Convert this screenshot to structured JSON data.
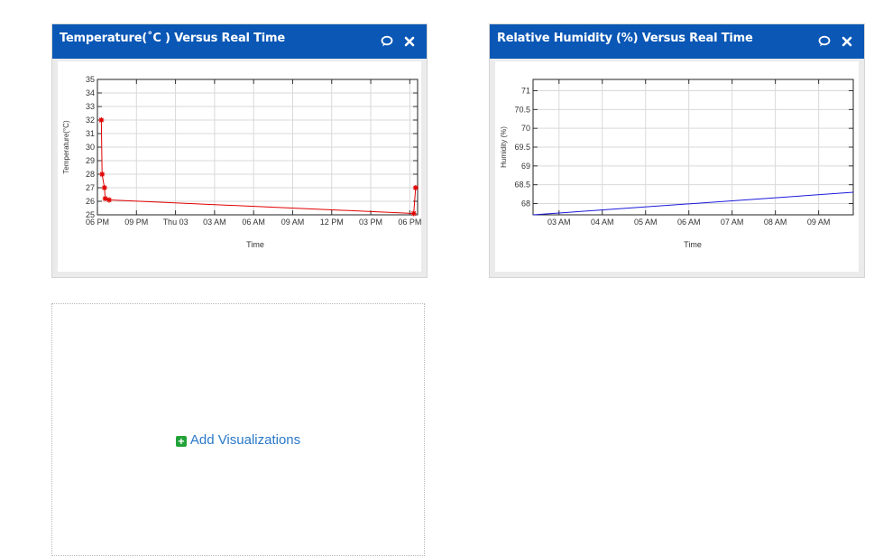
{
  "widgets": [
    {
      "title": "Temperature(˚C ) Versus Real Time",
      "comment_icon": "comment-icon",
      "close_icon": "close-icon"
    },
    {
      "title": "Relative Humidity (%) Versus Real Time",
      "comment_icon": "comment-icon",
      "close_icon": "close-icon"
    }
  ],
  "add": {
    "label": "Add Visualizations",
    "icon": "plus-square-icon",
    "color": "#22a33a"
  },
  "colors": {
    "header": "#0a57b5",
    "link": "#2a78c8"
  },
  "chart_data": [
    {
      "type": "line",
      "title": "",
      "xlabel": "Time",
      "ylabel": "Temperature(°C)",
      "ylim": [
        25,
        35
      ],
      "yticks": [
        "25",
        "26",
        "27",
        "28",
        "29",
        "30",
        "31",
        "32",
        "33",
        "34",
        "35"
      ],
      "xticks": [
        "06 PM",
        "09 PM",
        "Thu 03",
        "03 AM",
        "06 AM",
        "09 AM",
        "12 PM",
        "03 PM",
        "06 PM"
      ],
      "grid": true,
      "series": [
        {
          "color": "#e00000",
          "marker": "star",
          "points": [
            {
              "x": 0.1,
              "y": 32.0
            },
            {
              "x": 0.12,
              "y": 28.0
            },
            {
              "x": 0.18,
              "y": 27.0
            },
            {
              "x": 0.2,
              "y": 26.2
            },
            {
              "x": 0.3,
              "y": 26.1
            },
            {
              "x": 8.1,
              "y": 25.1
            },
            {
              "x": 8.15,
              "y": 27.0
            }
          ]
        }
      ]
    },
    {
      "type": "line",
      "title": "",
      "xlabel": "Time",
      "ylabel": "Humidity (%)",
      "ylim": [
        67.7,
        71.3
      ],
      "yticks": [
        "68",
        "68.5",
        "69",
        "69.5",
        "70",
        "70.5",
        "71"
      ],
      "xticks": [
        "03 AM",
        "04 AM",
        "05 AM",
        "06 AM",
        "07 AM",
        "08 AM",
        "09 AM"
      ],
      "grid": true,
      "series": [
        {
          "color": "#1a1adb",
          "points": [
            {
              "x": -0.6,
              "y": 67.7
            },
            {
              "x": 6.8,
              "y": 68.3
            }
          ]
        }
      ]
    }
  ]
}
